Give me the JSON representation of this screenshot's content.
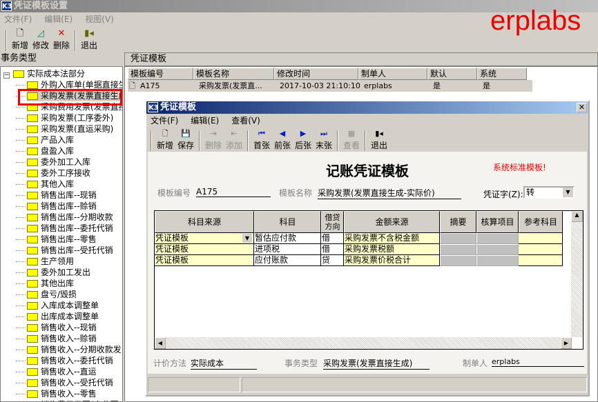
{
  "app": {
    "title": "凭证模板设置",
    "logo": "K3",
    "menu": [
      "文件(F)",
      "编辑(E)",
      "视图(V)"
    ],
    "toolbar": [
      {
        "label": "新增",
        "icon": "new-doc-icon"
      },
      {
        "label": "修改",
        "icon": "edit-icon"
      },
      {
        "label": "删除",
        "icon": "delete-icon"
      },
      {
        "label": "退出",
        "icon": "exit-icon"
      }
    ]
  },
  "watermark": "erplabs",
  "left": {
    "header": "事务类型",
    "root": "实际成本法部分",
    "items": [
      "外购入库单(单据直接生",
      "采购发票(发票直接生成",
      "采购费用发票(发票直接",
      "采购发票(工序委外)",
      "采购发票(直运采购)",
      "产品入库",
      "盘盈入库",
      "委外加工入库",
      "委外工序接收",
      "其他入库",
      "销售出库--现销",
      "销售出库--赊销",
      "销售出库--分期收款",
      "销售出库--委托代销",
      "销售出库--零售",
      "销售出库--受托代销",
      "生产领用",
      "委外加工发出",
      "其他出库",
      "盘亏/毁损",
      "入库成本调整单",
      "出库成本调整单",
      "销售收入--现销",
      "销售收入--赊销",
      "销售收入--分期收款发",
      "销售收入--委托代销",
      "销售收入--直运",
      "销售收入--受托代销",
      "销售收入--零售",
      "销售费用发票(交此票"
    ]
  },
  "right": {
    "header": "凭证模板",
    "columns": [
      "模板编号",
      "模板名称",
      "修改时间",
      "制单人",
      "默认",
      "系统"
    ],
    "rows": [
      [
        "A175",
        "采购发票(发票直...",
        "2017-10-03 21:10:10",
        "erplabs",
        "是",
        "是"
      ]
    ]
  },
  "dialog": {
    "title": "凭证模板",
    "logo": "K3",
    "menu": [
      "文件(F)",
      "编辑(E)",
      "查看(V)"
    ],
    "toolbar": [
      {
        "label": "新增",
        "icon": "new-doc-icon"
      },
      {
        "label": "保存",
        "icon": "save-icon"
      },
      {
        "label": "删除",
        "icon": "delete-row-icon",
        "disabled": true
      },
      {
        "label": "添加",
        "icon": "add-row-icon",
        "disabled": true
      },
      {
        "label": "首张",
        "icon": "first-icon"
      },
      {
        "label": "前张",
        "icon": "prev-icon"
      },
      {
        "label": "后张",
        "icon": "next-icon"
      },
      {
        "label": "末张",
        "icon": "last-icon"
      },
      {
        "label": "查看",
        "icon": "view-icon",
        "disabled": true
      },
      {
        "label": "退出",
        "icon": "exit-icon"
      }
    ],
    "heading": "记账凭证模板",
    "notice": "系统标准模板!",
    "template_no_label": "模板编号",
    "template_no": "A175",
    "template_name_label": "模板名称",
    "template_name": "采购发票(发票直接生成-实际价)",
    "voucher_word_label": "凭证字(Z):",
    "voucher_word": "转",
    "grid_columns": [
      "科目来源",
      "科目",
      "借贷方向",
      "金额来源",
      "摘要",
      "核算项目",
      "参考科目"
    ],
    "grid_rows": [
      [
        "凭证模板",
        "暂估应付款",
        "借",
        "采购发票不含税金额"
      ],
      [
        "凭证模板",
        "进项税",
        "借",
        "采购发票税额"
      ],
      [
        "凭证模板",
        "应付账款",
        "贷",
        "采购发票价税合计"
      ]
    ],
    "pricing_label": "计价方法",
    "pricing": "实际成本",
    "biz_type_label": "事务类型",
    "biz_type": "采购发票(发票直接生成)",
    "creator_label": "制单人",
    "creator": "erplabs"
  }
}
